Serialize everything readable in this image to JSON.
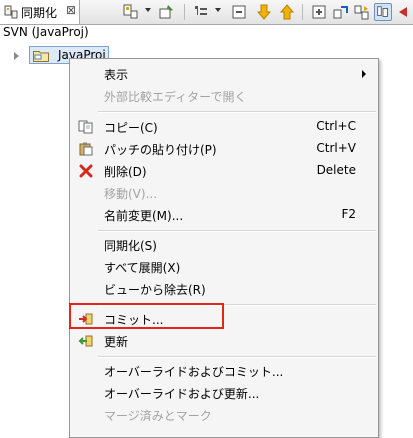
{
  "view": {
    "tab_label": "同期化",
    "tab_close": "⊠",
    "title": "SVN (JavaProj)",
    "tree_item": "JavaProj"
  },
  "toolbar": {
    "icons": [
      "sync-view-icon",
      "menu-dropdown",
      "pin-icon",
      "incoming-mode-icon",
      "mode-dropdown",
      "collapse-icon",
      "next-icon",
      "prev-icon",
      "expand-all-icon",
      "link-icon",
      "sync-icon",
      "refresh-icon",
      "selected-mode-icon"
    ]
  },
  "menu": {
    "items": [
      {
        "label": "表示",
        "shortcut": "",
        "submenu": true,
        "disabled": false
      },
      {
        "label": "外部比較エディターで開く",
        "shortcut": "",
        "disabled": true
      },
      {
        "label": "コピー(C)",
        "shortcut": "Ctrl+C",
        "icon": "copy-icon"
      },
      {
        "label": "パッチの貼り付け(P)",
        "shortcut": "Ctrl+V",
        "icon": "paste-icon"
      },
      {
        "label": "削除(D)",
        "shortcut": "Delete",
        "icon": "delete-icon"
      },
      {
        "label": "移動(V)...",
        "shortcut": "",
        "disabled": true
      },
      {
        "label": "名前変更(M)...",
        "shortcut": "F2"
      },
      {
        "label": "同期化(S)",
        "shortcut": ""
      },
      {
        "label": "すべて展開(X)",
        "shortcut": ""
      },
      {
        "label": "ビューから除去(R)",
        "shortcut": ""
      },
      {
        "label": "コミット...",
        "shortcut": "",
        "icon": "commit-icon"
      },
      {
        "label": "更新",
        "shortcut": "",
        "icon": "update-icon"
      },
      {
        "label": "オーバーライドおよびコミット...",
        "shortcut": ""
      },
      {
        "label": "オーバーライドおよび更新...",
        "shortcut": ""
      },
      {
        "label": "マージ済みとマーク",
        "shortcut": "",
        "disabled": true
      }
    ]
  },
  "colors": {
    "highlight_border": "#e2261d",
    "delete_red": "#d42a1e",
    "commit_red": "#c6312a",
    "update_green": "#3a9a3a"
  }
}
